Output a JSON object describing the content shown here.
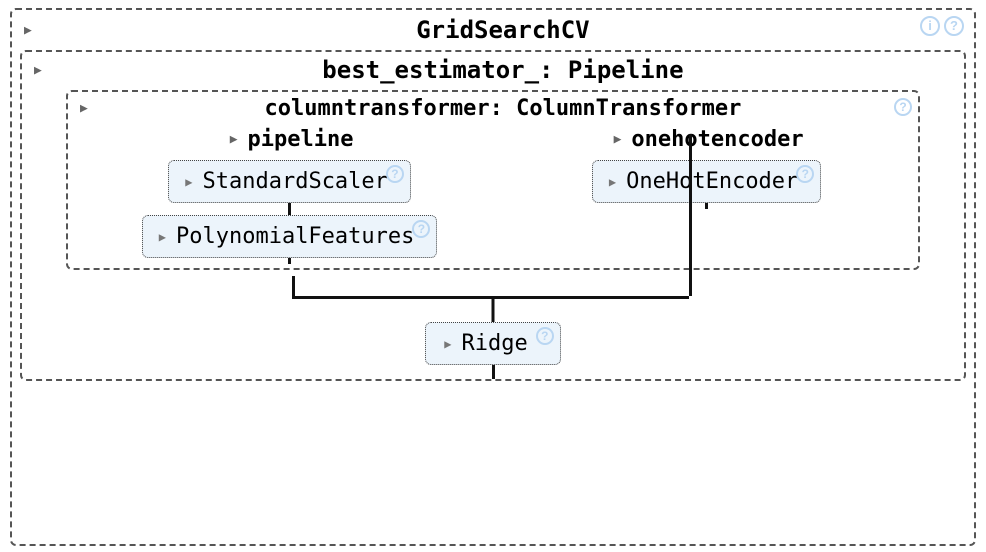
{
  "gridsearch": {
    "title": "GridSearchCV",
    "info_icon": "i",
    "help_icon": "?"
  },
  "best_estimator": {
    "title": "best_estimator_: Pipeline"
  },
  "columntransformer": {
    "title": "columntransformer: ColumnTransformer",
    "help_icon": "?"
  },
  "left_col": {
    "header": "pipeline",
    "steps": [
      {
        "name": "StandardScaler",
        "help_icon": "?"
      },
      {
        "name": "PolynomialFeatures",
        "help_icon": "?"
      }
    ]
  },
  "right_col": {
    "header": "onehotencoder",
    "steps": [
      {
        "name": "OneHotEncoder",
        "help_icon": "?"
      }
    ]
  },
  "final_step": {
    "name": "Ridge",
    "help_icon": "?"
  }
}
